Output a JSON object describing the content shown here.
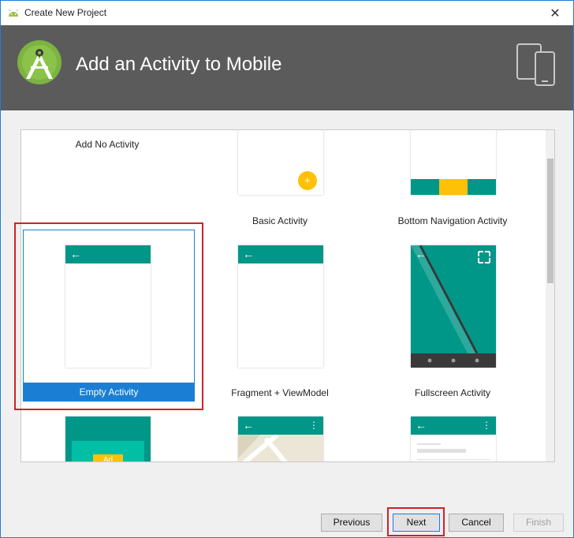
{
  "window": {
    "title": "Create New Project"
  },
  "header": {
    "title": "Add an Activity to Mobile"
  },
  "templates": [
    {
      "label": "Add No Activity"
    },
    {
      "label": "Basic Activity"
    },
    {
      "label": "Bottom Navigation Activity"
    },
    {
      "label": "Empty Activity",
      "selected": true
    },
    {
      "label": "Fragment + ViewModel"
    },
    {
      "label": "Fullscreen Activity"
    },
    {
      "label": "Ad",
      "partial": true
    }
  ],
  "buttons": {
    "previous": "Previous",
    "next": "Next",
    "cancel": "Cancel",
    "finish": "Finish"
  },
  "icons": {
    "back": "←",
    "menu": "⋮",
    "plus": "+",
    "close": "✕"
  },
  "colors": {
    "accent": "#009688",
    "selection": "#1a7fd4",
    "fab": "#ffc107",
    "header": "#5b5b5b",
    "highlight": "#d0202a"
  }
}
